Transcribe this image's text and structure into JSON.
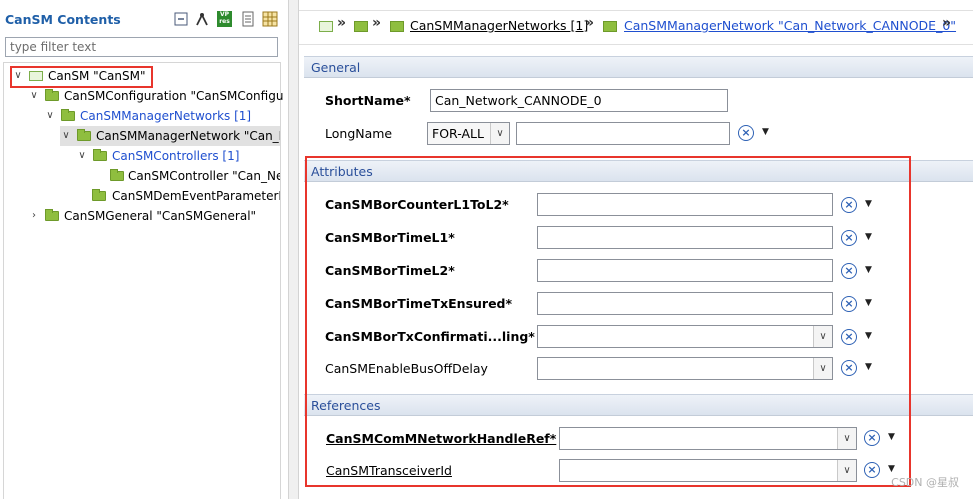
{
  "left": {
    "title": "CanSM Contents",
    "filter_placeholder": "type filter text",
    "toolbar_icons": [
      "collapse-all-icon",
      "link-icon",
      "vp-res-icon",
      "document-icon",
      "grid-settings-icon"
    ],
    "vp_badge_top": "VP",
    "vp_badge_bottom": "res",
    "tree": {
      "root": "CanSM \"CanSM\"",
      "config": "CanSMConfiguration \"CanSMConfigu",
      "manager_networks": "CanSMManagerNetworks [1]",
      "manager_network": "CanSMManagerNetwork \"Can_N",
      "controllers": "CanSMControllers [1]",
      "controller": "CanSMController \"Can_Ne",
      "dem_event": "CanSMDemEventParameterR",
      "general": "CanSMGeneral \"CanSMGeneral\""
    }
  },
  "breadcrumb": {
    "link_networks": "CanSMManagerNetworks [1]",
    "link_network": "CanSMManagerNetwork \"Can_Network_CANNODE_0\"",
    "separator": "»"
  },
  "general": {
    "header": "General",
    "short_name_label": "ShortName*",
    "short_name_value": "Can_Network_CANNODE_0",
    "long_name_label": "LongName",
    "long_name_lang": "FOR-ALL",
    "long_name_value": ""
  },
  "attributes": {
    "header": "Attributes",
    "fields": [
      {
        "label": "CanSMBorCounterL1ToL2*",
        "value": ""
      },
      {
        "label": "CanSMBorTimeL1*",
        "value": ""
      },
      {
        "label": "CanSMBorTimeL2*",
        "value": ""
      },
      {
        "label": "CanSMBorTimeTxEnsured*",
        "value": ""
      },
      {
        "label": "CanSMBorTxConfirmati...ling*",
        "value": ""
      },
      {
        "label": "CanSMEnableBusOffDelay",
        "value": ""
      }
    ]
  },
  "references": {
    "header": "References",
    "fields": [
      {
        "label": "CanSMComMNetworkHandleRef*",
        "value": ""
      },
      {
        "label": "CanSMTransceiverId",
        "value": ""
      }
    ]
  },
  "watermark": "CSDN @星叔",
  "colors": {
    "highlight": "#e8352c",
    "link": "#1f4fcf",
    "section_text": "#2a4f9a",
    "folder": "#8fbe3f"
  }
}
